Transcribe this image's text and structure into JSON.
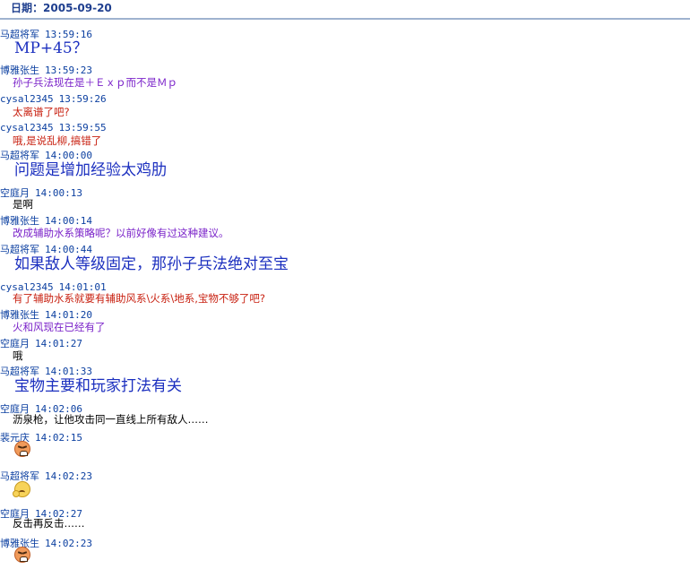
{
  "date": {
    "label": "日期：",
    "value": "2005-09-20"
  },
  "messages": [
    {
      "user": "马超将军",
      "time": "13:59:16",
      "text": "MP+45？",
      "style": "big"
    },
    {
      "user": "博雅张生",
      "time": "13:59:23",
      "text": "孙子兵法现在是＋Ｅｘｐ而不是Ｍｐ",
      "style": "purple"
    },
    {
      "user": "cysal2345",
      "time": "13:59:26",
      "text": "太离谱了吧?",
      "style": "red"
    },
    {
      "user": "cysal2345",
      "time": "13:59:55",
      "text": "哦,是说乱柳,搞错了",
      "style": "red"
    },
    {
      "user": "马超将军",
      "time": "14:00:00",
      "text": "问题是增加经验太鸡肋",
      "style": "big"
    },
    {
      "user": "空庭月",
      "time": "14:00:13",
      "text": "是啊",
      "style": "black"
    },
    {
      "user": "博雅张生",
      "time": "14:00:14",
      "text": "改成辅助水系策略呢？以前好像有过这种建议。",
      "style": "purple"
    },
    {
      "user": "马超将军",
      "time": "14:00:44",
      "text": "如果敌人等级固定，那孙子兵法绝对至宝",
      "style": "big"
    },
    {
      "user": "cysal2345",
      "time": "14:01:01",
      "text": "有了辅助水系就要有辅助风系\\火系\\地系,宝物不够了吧?",
      "style": "red"
    },
    {
      "user": "博雅张生",
      "time": "14:01:20",
      "text": "火和风现在已经有了",
      "style": "purple"
    },
    {
      "user": "空庭月",
      "time": "14:01:27",
      "text": "哦",
      "style": "black"
    },
    {
      "user": "马超将军",
      "time": "14:01:33",
      "text": "宝物主要和玩家打法有关",
      "style": "big"
    },
    {
      "user": "空庭月",
      "time": "14:02:06",
      "text": "沥泉枪，让他攻击同一直线上所有敌人……",
      "style": "black"
    },
    {
      "user": "裴元庆",
      "time": "14:02:15",
      "emoticon": "angry-face-icon"
    },
    {
      "user": "马超将军",
      "time": "14:02:23",
      "emoticon": "thinking-face-icon"
    },
    {
      "user": "空庭月",
      "time": "14:02:27",
      "text": "反击再反击……",
      "style": "black"
    },
    {
      "user": "博雅张生",
      "time": "14:02:23",
      "emoticon": "angry-face-icon"
    }
  ]
}
